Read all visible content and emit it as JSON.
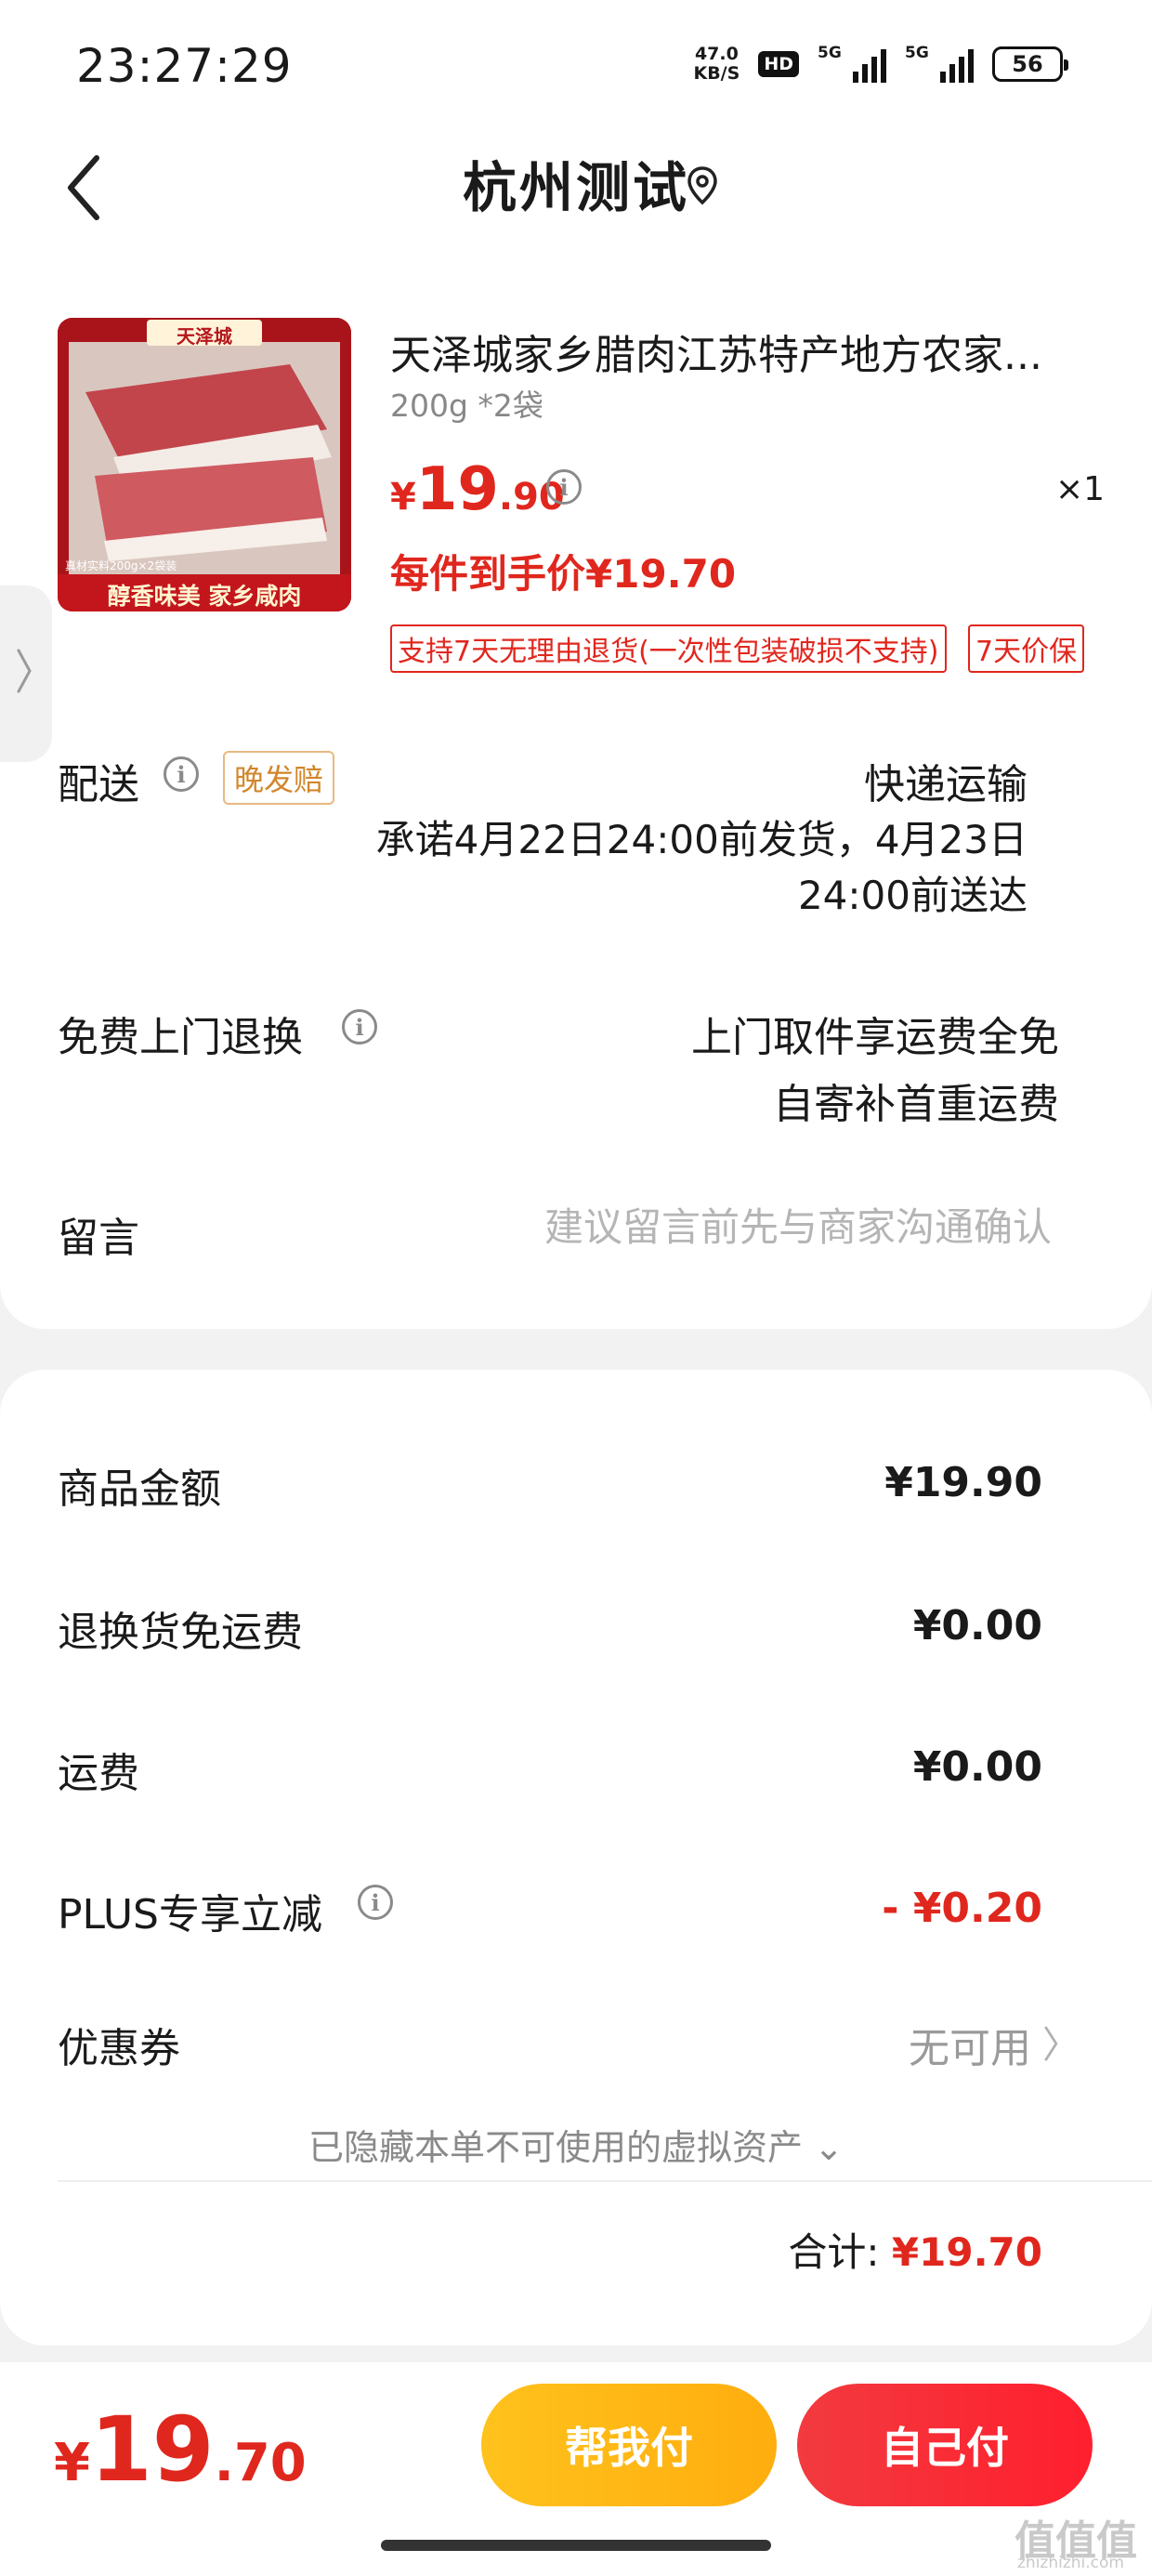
{
  "status_bar": {
    "time": "23:27:29",
    "net_speed_value": "47.0",
    "net_speed_unit": "KB/S",
    "hd_label": "HD",
    "signal1_label": "5G",
    "signal2_label": "5G",
    "battery": "56"
  },
  "header": {
    "back_icon": "chevron-left-icon",
    "title": "杭州测试",
    "location_icon": "location-pin-icon"
  },
  "product": {
    "image_brand": "天泽城",
    "image_note": "真材实料200g×2袋装",
    "image_slogan": "醇香味美 家乡咸肉",
    "name": "天泽城家乡腊肉江苏特产地方农家...",
    "spec": "200g *2袋",
    "price_currency": "¥",
    "price_int": "19",
    "price_dec": ".90",
    "quantity": "×1",
    "final_price": "每件到手价¥19.70",
    "tags": [
      "支持7天无理由退货(一次性包装破损不支持)",
      "7天价保"
    ]
  },
  "delivery": {
    "label": "配送",
    "badge": "晚发赔",
    "method": "快递运输",
    "promise_line1": "承诺4月22日24:00前发货，4月23日",
    "promise_line2": "24:00前送达"
  },
  "return_service": {
    "label": "免费上门退换",
    "line1": "上门取件享运费全免",
    "line2": "自寄补首重运费"
  },
  "message": {
    "label": "留言",
    "placeholder": "建议留言前先与商家沟通确认"
  },
  "fees": {
    "goods_label": "商品金额",
    "goods_value": "¥19.90",
    "return_label": "退换货免运费",
    "return_value": "¥0.00",
    "shipping_label": "运费",
    "shipping_value": "¥0.00",
    "plus_label": "PLUS专享立减",
    "plus_value": "- ¥0.20",
    "coupon_label": "优惠券",
    "coupon_value": "无可用",
    "hidden_assets": "已隐藏本单不可使用的虚拟资产",
    "total_label": "合计:",
    "total_value": "¥19.70"
  },
  "bottom": {
    "price_currency": "¥",
    "price_int": "19",
    "price_dec": ".70",
    "help_pay": "帮我付",
    "self_pay": "自己付"
  },
  "watermark": {
    "text": "值值值",
    "sub": "zhizhizhi.com"
  },
  "colors": {
    "accent_red": "#e0271e",
    "help_pay_yellow": "#ffb814",
    "late_badge": "#d2862b"
  }
}
